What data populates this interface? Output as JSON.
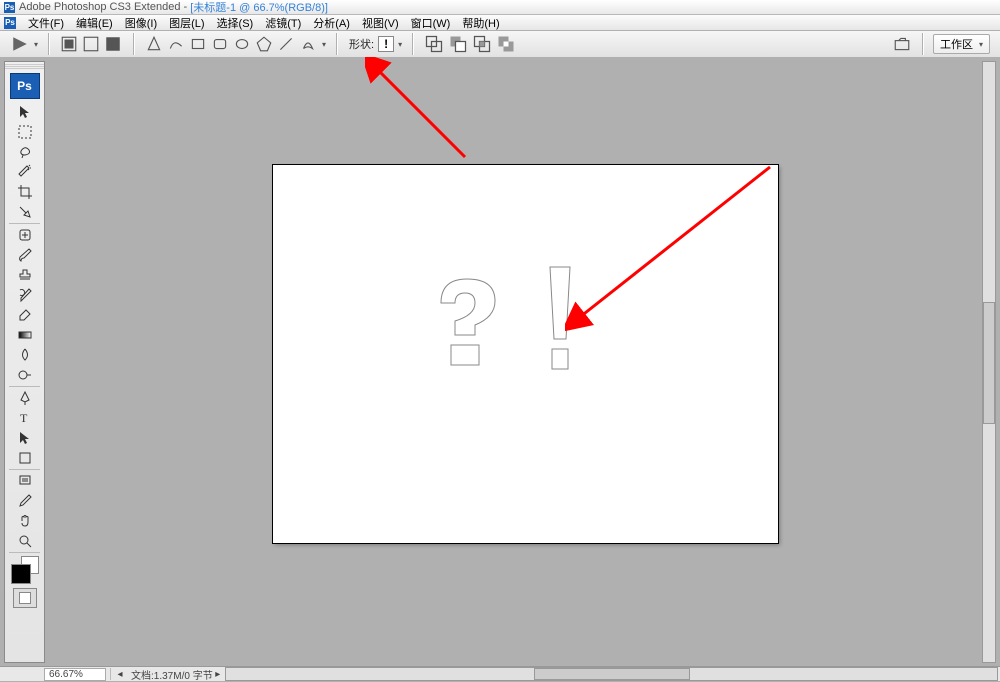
{
  "title": {
    "app": "Adobe Photoshop CS3 Extended",
    "document": "[未标题-1 @ 66.7%(RGB/8)]"
  },
  "menu": {
    "items": [
      "文件(F)",
      "编辑(E)",
      "图像(I)",
      "图层(L)",
      "选择(S)",
      "滤镜(T)",
      "分析(A)",
      "视图(V)",
      "窗口(W)",
      "帮助(H)"
    ]
  },
  "options": {
    "shape_label": "形状:",
    "shape_selected": "!",
    "workspace_label": "工作区"
  },
  "tools": {
    "logo": "Ps",
    "items": [
      "move",
      "marquee",
      "lasso",
      "wand",
      "crop",
      "slice",
      "healing",
      "brush",
      "stamp",
      "history-brush",
      "eraser",
      "gradient",
      "blur",
      "dodge",
      "pen",
      "type",
      "path-select",
      "shape",
      "notes",
      "eyedropper",
      "hand",
      "zoom"
    ]
  },
  "status": {
    "zoom": "66.67%",
    "doc_info": "文档:1.37M/0 字节"
  },
  "canvas": {
    "shapes": [
      "question-mark",
      "exclamation-mark"
    ]
  }
}
